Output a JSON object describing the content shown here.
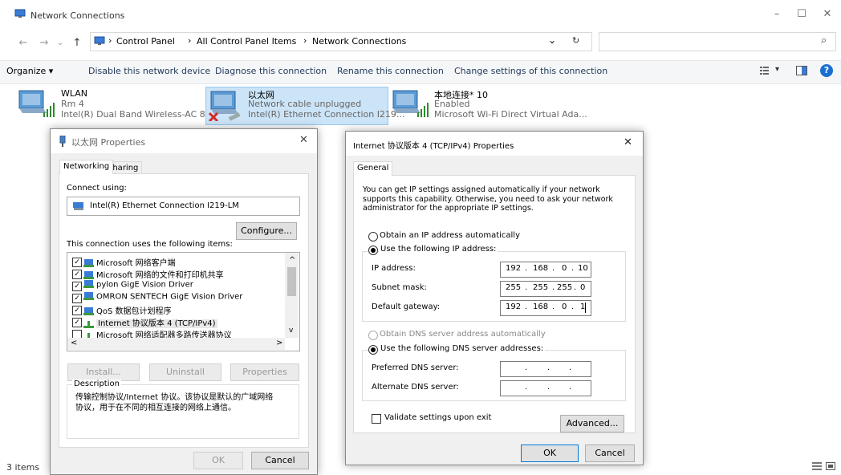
{
  "window": {
    "title": "Network Connections",
    "minimize": "–",
    "maximize": "☐",
    "close": "✕"
  },
  "nav": {
    "back": "←",
    "forward": "→",
    "recent": "⌄",
    "up": "↑",
    "sep": "›",
    "dropdown": "⌄",
    "refresh": "↻",
    "search_glyph": "⌕"
  },
  "breadcrumb": [
    "Control Panel",
    "All Control Panel Items",
    "Network Connections"
  ],
  "commands": {
    "organize": "Organize ▾",
    "disable": "Disable this network device",
    "diagnose": "Diagnose this connection",
    "rename": "Rename this connection",
    "change": "Change settings of this connection",
    "view_arrow": "▾",
    "help": "?"
  },
  "connections": [
    {
      "name": "WLAN",
      "status": "Rm 4",
      "device": "Intel(R) Dual Band Wireless-AC 82..."
    },
    {
      "name": "以太网",
      "status": "Network cable unplugged",
      "device": "Intel(R) Ethernet Connection I219..."
    },
    {
      "name": "本地连接* 10",
      "status": "Enabled",
      "device": "Microsoft Wi-Fi Direct Virtual Ada..."
    }
  ],
  "status_bar": {
    "items": "3 items"
  },
  "properties_dialog": {
    "title": "以太网 Properties",
    "close": "✕",
    "tabs": [
      "Networking",
      "Sharing"
    ],
    "connect_using_label": "Connect using:",
    "adapter": "Intel(R) Ethernet Connection I219-LM",
    "configure": "Configure...",
    "items_label": "This connection uses the following items:",
    "items": [
      {
        "label": "Microsoft 网络客户端",
        "checked": true
      },
      {
        "label": "Microsoft 网络的文件和打印机共享",
        "checked": true
      },
      {
        "label": "pylon GigE Vision Driver",
        "checked": true
      },
      {
        "label": "OMRON SENTECH GigE Vision Driver",
        "checked": true
      },
      {
        "label": "QoS 数据包计划程序",
        "checked": true
      },
      {
        "label": "Internet 协议版本 4 (TCP/IPv4)",
        "checked": true
      },
      {
        "label": "Microsoft 网络适配器多路传送器协议",
        "checked": false
      }
    ],
    "check_glyph": "✓",
    "scroll_up": "^",
    "scroll_down": "v",
    "scroll_left": "<",
    "scroll_right": ">",
    "install": "Install...",
    "uninstall": "Uninstall",
    "properties": "Properties",
    "description_label": "Description",
    "description": "传输控制协议/Internet 协议。该协议是默认的广域网络协议，用于在不同的相互连接的网络上通信。",
    "ok": "OK",
    "cancel": "Cancel"
  },
  "ipv4_dialog": {
    "title": "Internet 协议版本 4 (TCP/IPv4) Properties",
    "close": "✕",
    "tab": "General",
    "intro": "You can get IP settings assigned automatically if your network supports this capability. Otherwise, you need to ask your network administrator for the appropriate IP settings.",
    "obtain_auto": "Obtain an IP address automatically",
    "use_following": "Use the following IP address:",
    "ip_label": "IP address:",
    "ip": [
      "192",
      "168",
      "0",
      "10"
    ],
    "subnet_label": "Subnet mask:",
    "subnet": [
      "255",
      "255",
      "255",
      "0"
    ],
    "gateway_label": "Default gateway:",
    "gateway": [
      "192",
      "168",
      "0",
      "1"
    ],
    "dns_auto": "Obtain DNS server address automatically",
    "dns_use": "Use the following DNS server addresses:",
    "preferred_label": "Preferred DNS server:",
    "alternate_label": "Alternate DNS server:",
    "dot": ".",
    "validate": "Validate settings upon exit",
    "advanced": "Advanced...",
    "ok": "OK",
    "cancel": "Cancel"
  },
  "colors": {
    "accent": "#0078d7",
    "link": "#1e395b",
    "help": "#1a6fd1"
  }
}
